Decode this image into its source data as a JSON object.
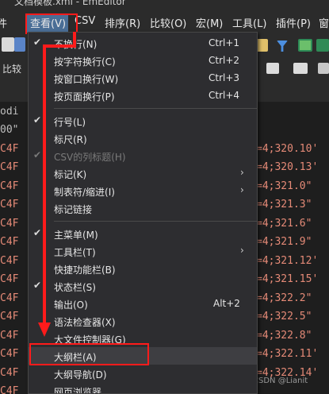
{
  "window": {
    "title": "文档模板.xml - EmEditor"
  },
  "menubar": {
    "items": [
      {
        "label": "件"
      },
      {
        "label": "查看(V)"
      },
      {
        "label": "CSV"
      },
      {
        "label": "排序(R)"
      },
      {
        "label": "比较(O)"
      },
      {
        "label": "宏(M)"
      },
      {
        "label": "工具(L)"
      },
      {
        "label": "插件(P)"
      },
      {
        "label": "窗"
      }
    ]
  },
  "toolbar": {
    "compare_label": "比较"
  },
  "editor": {
    "left_fragments": [
      "odi",
      "00\"",
      "C4F",
      "C4F",
      "C4F",
      "C4F",
      "C4F",
      "C4F",
      "C4F",
      "C4F",
      "C4F",
      "C4F",
      "C4F",
      "C4F",
      "C4F",
      "C4F"
    ],
    "right_fragments": [
      "",
      "",
      "=4;320.10'",
      "=4;320.13'",
      "=4;321.0\"",
      "=4;321.3\"",
      "=4;321.6\"",
      "=4;321.9\"",
      "=4;321.12'",
      "=4;321.15'",
      "=4;322.2\"",
      "=4;322.5\"",
      "=4;322.8\"",
      "=4;322.11'",
      "=4;322.14'",
      ""
    ]
  },
  "view_menu": {
    "items": [
      {
        "label": "不换行(N)",
        "shortcut": "Ctrl+1",
        "check": "✔",
        "arrow": ""
      },
      {
        "label": "按字符换行(C)",
        "shortcut": "Ctrl+2",
        "check": "",
        "arrow": ""
      },
      {
        "label": "按窗口换行(W)",
        "shortcut": "Ctrl+3",
        "check": "",
        "arrow": ""
      },
      {
        "label": "按页面换行(P)",
        "shortcut": "Ctrl+4",
        "check": "",
        "arrow": ""
      },
      {
        "label": "行号(L)",
        "shortcut": "",
        "check": "✔",
        "arrow": ""
      },
      {
        "label": "标尺(R)",
        "shortcut": "",
        "check": "",
        "arrow": ""
      },
      {
        "label": "CSV的列标题(H)",
        "shortcut": "",
        "check": "✔",
        "arrow": ""
      },
      {
        "label": "标记(K)",
        "shortcut": "",
        "check": "",
        "arrow": "›"
      },
      {
        "label": "制表符/缩进(I)",
        "shortcut": "",
        "check": "",
        "arrow": "›"
      },
      {
        "label": "标记链接",
        "shortcut": "",
        "check": "",
        "arrow": ""
      },
      {
        "label": "主菜单(M)",
        "shortcut": "",
        "check": "✔",
        "arrow": ""
      },
      {
        "label": "工具栏(T)",
        "shortcut": "",
        "check": "",
        "arrow": "›"
      },
      {
        "label": "快捷功能栏(B)",
        "shortcut": "",
        "check": "",
        "arrow": ""
      },
      {
        "label": "状态栏(S)",
        "shortcut": "",
        "check": "✔",
        "arrow": ""
      },
      {
        "label": "输出(O)",
        "shortcut": "Alt+2",
        "check": "",
        "arrow": ""
      },
      {
        "label": "语法检查器(X)",
        "shortcut": "",
        "check": "",
        "arrow": ""
      },
      {
        "label": "大文件控制器(G)",
        "shortcut": "",
        "check": "",
        "arrow": ""
      },
      {
        "label": "大纲栏(A)",
        "shortcut": "",
        "check": "",
        "arrow": ""
      },
      {
        "label": "大纲导航(D)",
        "shortcut": "",
        "check": "",
        "arrow": ""
      },
      {
        "label": "网页浏览器",
        "shortcut": "",
        "check": "",
        "arrow": ""
      }
    ]
  },
  "watermark": "CSDN @Lianit",
  "colors": {
    "highlight_box": "#ff1b1b",
    "menu_highlight": "#4a6e96",
    "code_text": "#e58a77"
  }
}
